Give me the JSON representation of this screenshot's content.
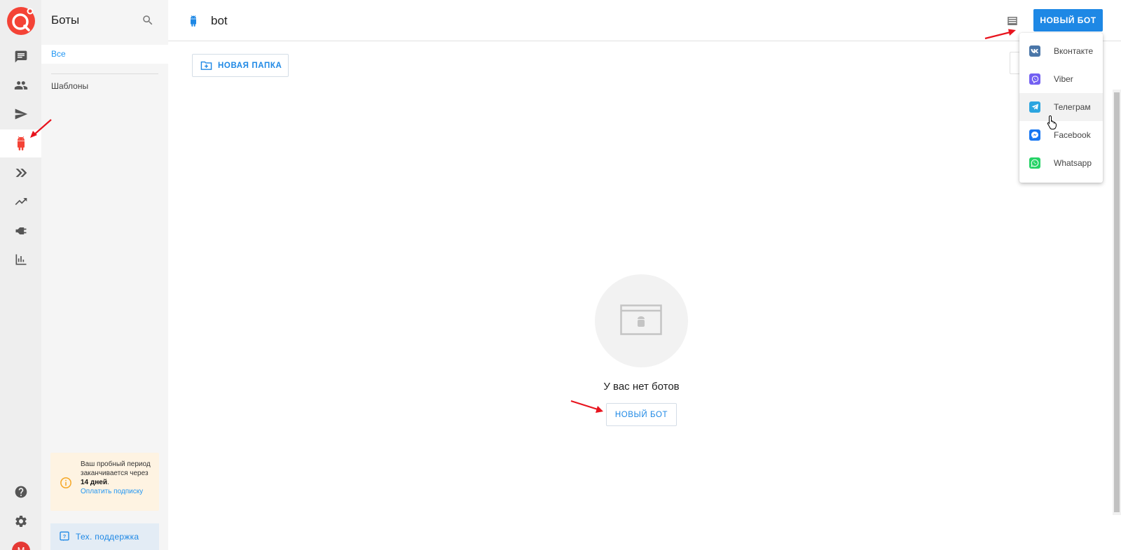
{
  "sidebar": {
    "title": "Боты",
    "nav_all": "Все",
    "nav_templates": "Шаблоны",
    "trial": {
      "line1": "Ваш пробный период заканчивается через ",
      "days": "14 дней",
      "period": ".",
      "link": "Оплатить подписку"
    },
    "support_label": "Тех. поддержка",
    "avatar_letter": "M"
  },
  "rail": {
    "items": [
      "chat-icon",
      "contacts-icon",
      "broadcast-icon",
      "bot-icon",
      "funnels-icon",
      "analytics-icon",
      "integrations-icon",
      "reports-icon"
    ],
    "active": "bot-icon",
    "bottom": [
      "help-icon",
      "settings-icon"
    ]
  },
  "header": {
    "title": "bot",
    "new_bot_label": "НОВЫЙ БОТ"
  },
  "toolbar": {
    "new_folder_label": "НОВАЯ ПАПКА"
  },
  "empty_state": {
    "message": "У вас нет ботов",
    "button_label": "НОВЫЙ БОТ"
  },
  "dropdown": {
    "items": [
      {
        "label": "Вконтакте",
        "icon": "vk-icon",
        "color": "#4a76a8"
      },
      {
        "label": "Viber",
        "icon": "viber-icon",
        "color": "#7360f2"
      },
      {
        "label": "Телеграм",
        "icon": "telegram-icon",
        "color": "#2ca5e0"
      },
      {
        "label": "Facebook",
        "icon": "messenger-icon",
        "color": "#1877f2"
      },
      {
        "label": "Whatsapp",
        "icon": "whatsapp-icon",
        "color": "#25d366"
      }
    ],
    "hovered_index": 2
  },
  "colors": {
    "accent": "#1e88e5",
    "active_icon": "#f44336",
    "annotation_arrow": "#e8141e"
  }
}
